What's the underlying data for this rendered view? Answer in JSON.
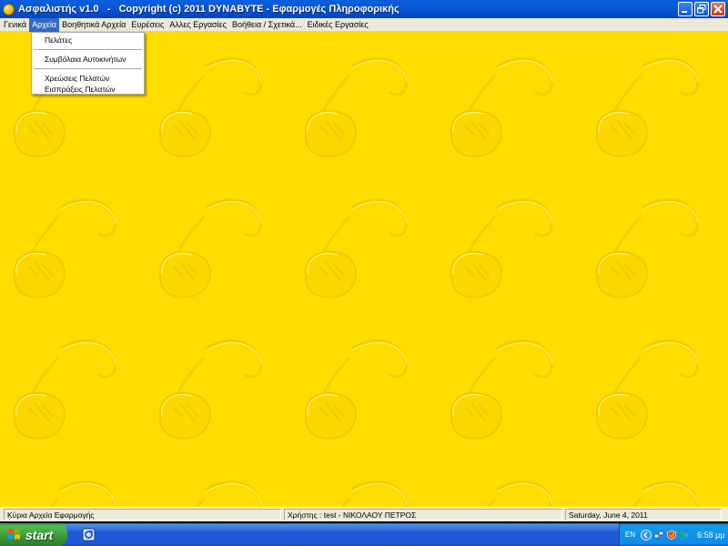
{
  "window": {
    "title": "Ασφαλιστής v1.0   -   Copyright (c) 2011 DYNABYTE - Εφαρμογές Πληροφορικής"
  },
  "menubar": {
    "items": [
      {
        "label": "Γενικά"
      },
      {
        "label": "Αρχεία"
      },
      {
        "label": "Βοηθητικά Αρχεία"
      },
      {
        "label": "Ευρέσεις"
      },
      {
        "label": "Αλλες Εργασίες"
      },
      {
        "label": "Βοήθεια / Σχετικά..."
      },
      {
        "label": "Ειδικές Εργασίες"
      }
    ]
  },
  "dropdown": {
    "items": [
      {
        "label": "Πελάτες"
      },
      {
        "label": "Συμβόλαια Αυτοκινήτων"
      },
      {
        "label": "Χρεώσεις Πελατών"
      },
      {
        "label": "Εισπράξεις Πελατών"
      }
    ]
  },
  "statusbar": {
    "left": "Κύρια Αρχεία Εφαρμογής",
    "middle": "Χρήστης : test  -  ΝΙΚΟΛΑΟΥ ΠΕΤΡΟΣ",
    "right": "Saturday, June  4, 2011"
  },
  "taskbar": {
    "start_label": "start",
    "language": "EN",
    "clock": "6:58 μμ"
  },
  "colors": {
    "desktop_background": "#ffdd00",
    "titlebar": "#0858d6",
    "menu_highlight": "#316ac5"
  }
}
